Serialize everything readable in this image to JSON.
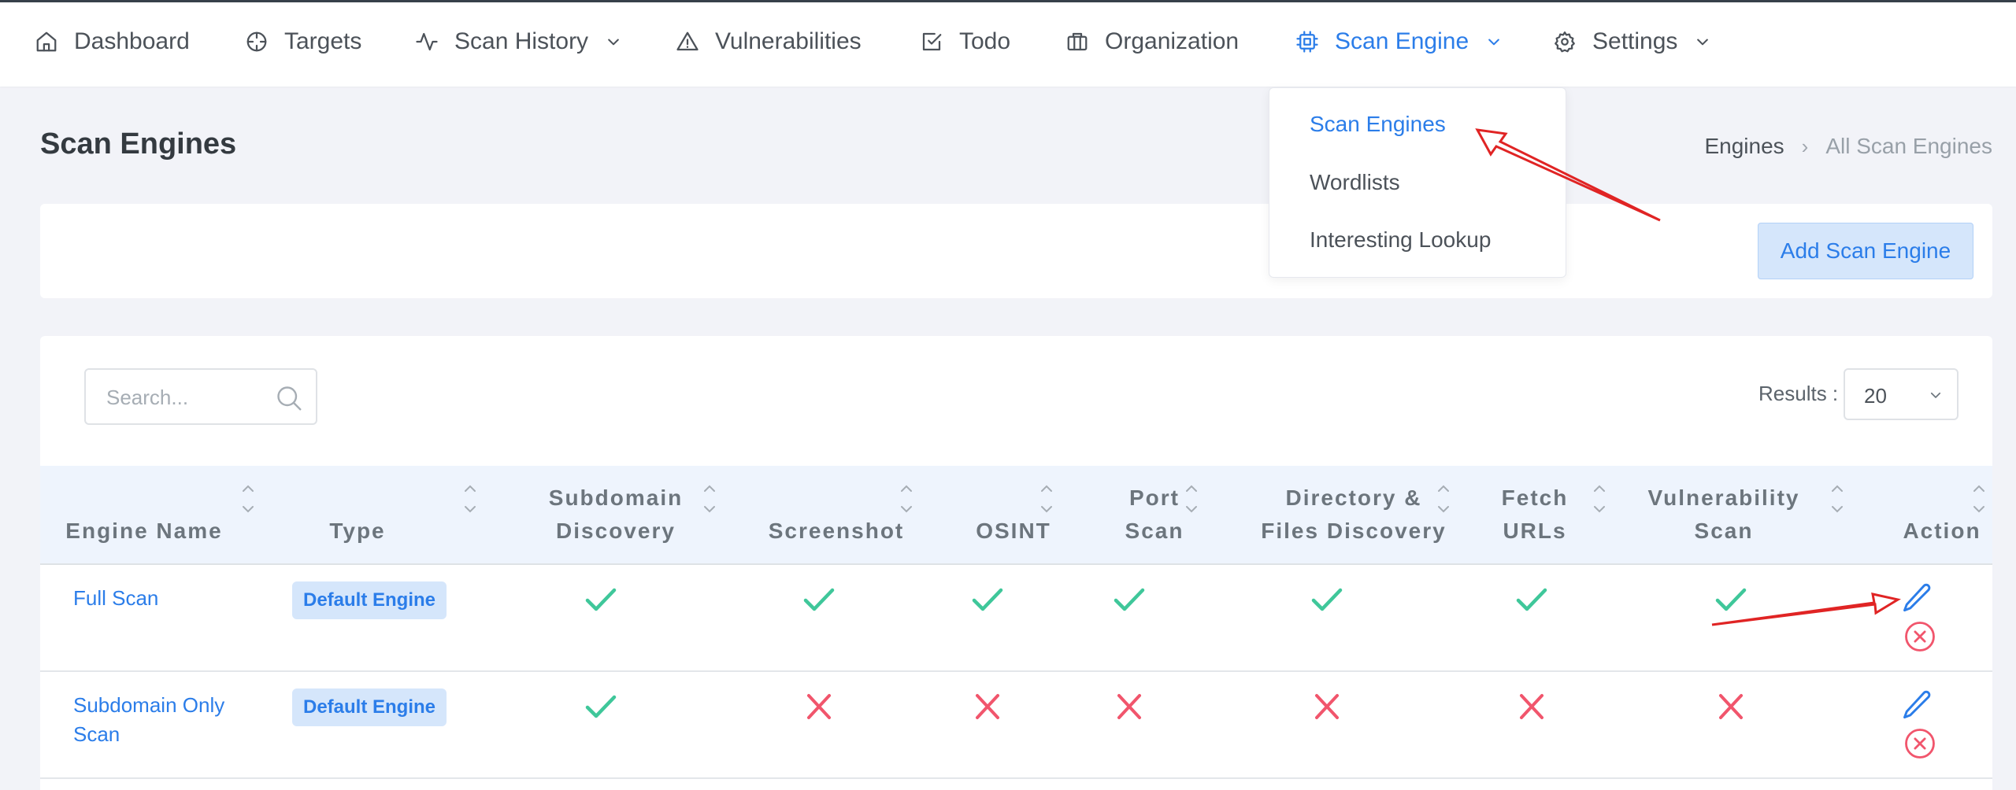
{
  "nav": {
    "dashboard": "Dashboard",
    "targets": "Targets",
    "scan_history": "Scan History",
    "vulnerabilities": "Vulnerabilities",
    "todo": "Todo",
    "organization": "Organization",
    "scan_engine": "Scan Engine",
    "settings": "Settings"
  },
  "dropdown": {
    "items": [
      "Scan Engines",
      "Wordlists",
      "Interesting Lookup"
    ],
    "active": "Scan Engines"
  },
  "page": {
    "title": "Scan Engines",
    "breadcrumb": [
      "Engines",
      "All Scan Engines"
    ],
    "add_button": "Add Scan Engine"
  },
  "table": {
    "search_placeholder": "Search...",
    "results_label": "Results :",
    "results_value": "20",
    "headers": {
      "engine_name": "Engine Name",
      "type": "Type",
      "subdomain_1": "Subdomain",
      "subdomain_2": "Discovery",
      "screenshot": "Screenshot",
      "osint": "OSINT",
      "port_1": "Port",
      "port_2": "Scan",
      "dir_1": "Directory &",
      "dir_2": "Files Discovery",
      "fetch_1": "Fetch",
      "fetch_2": "URLs",
      "vuln_1": "Vulnerability",
      "vuln_2": "Scan",
      "action": "Action"
    },
    "rows": [
      {
        "name": "Full Scan",
        "type": "Default Engine",
        "features": [
          true,
          true,
          true,
          true,
          true,
          true,
          true
        ]
      },
      {
        "name": "Subdomain Only Scan",
        "type": "Default Engine",
        "features": [
          true,
          false,
          false,
          false,
          false,
          false,
          false
        ]
      }
    ]
  },
  "colors": {
    "accent": "#2b7de9",
    "check": "#3fc79a",
    "cross": "#f1556c",
    "annotation": "#e02424"
  },
  "icons": {
    "check": "check-icon",
    "cross": "cross-icon",
    "edit": "pencil-icon",
    "delete": "circle-x-icon"
  }
}
